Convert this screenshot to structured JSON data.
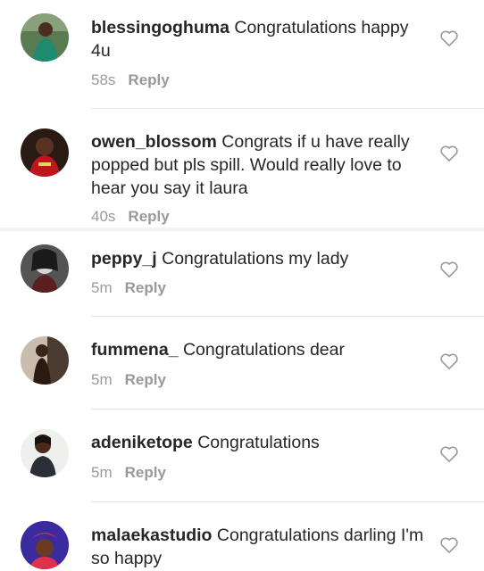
{
  "comments": [
    {
      "username": "blessingoghuma",
      "text": "Congratulations happy 4u",
      "time": "58s",
      "reply": "Reply"
    },
    {
      "username": "owen_blossom",
      "text": "Congrats if u have really popped but pls spill. Would really love to hear you say it laura",
      "time": "40s",
      "reply": "Reply"
    },
    {
      "username": "peppy_j",
      "text": "Congratulations my lady",
      "time": "5m",
      "reply": "Reply"
    },
    {
      "username": "fummena_",
      "text": "Congratulations dear",
      "time": "5m",
      "reply": "Reply"
    },
    {
      "username": "adeniketope",
      "text": "Congratulations",
      "time": "5m",
      "reply": "Reply"
    },
    {
      "username": "malaekastudio",
      "text": "Congratulations darling I'm so happy",
      "time": "",
      "reply": ""
    }
  ],
  "colors": {
    "text": "#262626",
    "meta": "#9a9a9a",
    "divider": "#e6e6e6"
  },
  "icons": {
    "like": "heart-outline-icon"
  }
}
